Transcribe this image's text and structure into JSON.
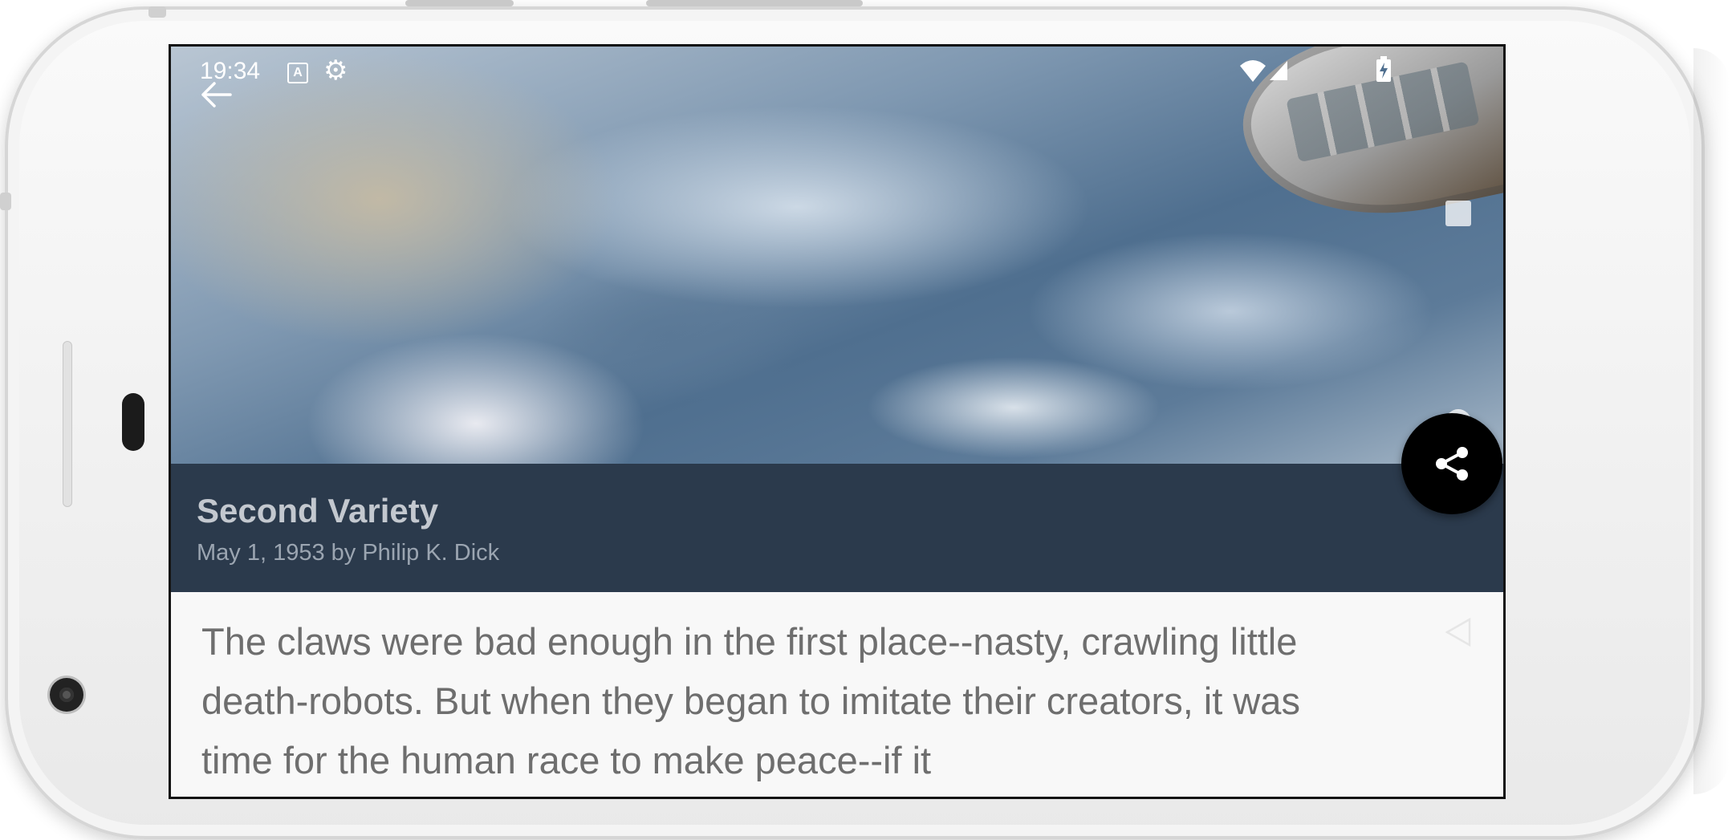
{
  "status_bar": {
    "time": "19:34",
    "notification_glyph": "A",
    "icons": [
      "text-notification-icon",
      "settings-icon",
      "wifi-icon",
      "signal-icon",
      "battery-charging-icon"
    ]
  },
  "toolbar": {
    "back_icon": "arrow-back-icon"
  },
  "article": {
    "title": "Second Variety",
    "byline": "May 1, 1953 by Philip K. Dick",
    "body": "The claws were bad enough in the first place--nasty, crawling little death-robots. But when they began to imitate their creators, it was time for the human race to make peace--if it"
  },
  "fab": {
    "icon": "share-icon"
  },
  "navigation_bar": {
    "icons": [
      "recents-icon",
      "home-icon",
      "back-icon"
    ]
  },
  "colors": {
    "title_bar": "#2b3a4c",
    "title_text": "#c3c8cf",
    "byline_text": "#9ba5b1",
    "body_background": "#f8f8f8",
    "body_text": "#6e6e6e",
    "fab_background": "#000000"
  }
}
